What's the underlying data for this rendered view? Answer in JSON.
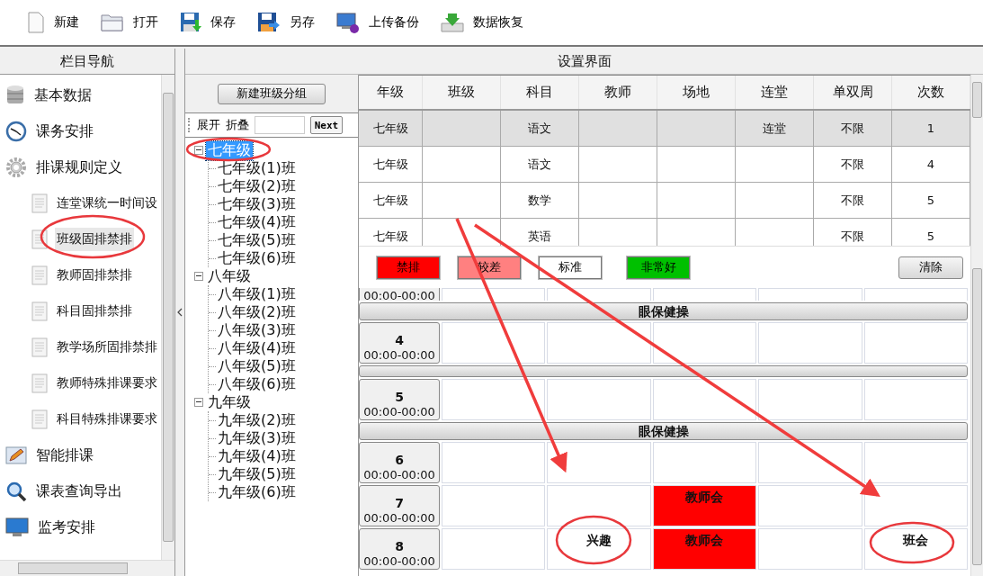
{
  "toolbar": [
    {
      "kind": "new",
      "label": "新建"
    },
    {
      "kind": "open",
      "label": "打开"
    },
    {
      "kind": "save",
      "label": "保存"
    },
    {
      "kind": "saveas",
      "label": "另存"
    },
    {
      "kind": "upload",
      "label": "上传备份"
    },
    {
      "kind": "restore",
      "label": "数据恢复"
    }
  ],
  "nav": {
    "title": "栏目导航",
    "items": [
      {
        "kind": "section",
        "label": "基本数据",
        "selected": false
      },
      {
        "kind": "section",
        "label": "课务安排",
        "selected": false
      },
      {
        "kind": "section",
        "label": "排课规则定义",
        "selected": false
      },
      {
        "kind": "sub",
        "label": "连堂课统一时间设",
        "selected": false
      },
      {
        "kind": "sub",
        "label": "班级固排禁排",
        "selected": true
      },
      {
        "kind": "sub",
        "label": "教师固排禁排",
        "selected": false
      },
      {
        "kind": "sub",
        "label": "科目固排禁排",
        "selected": false
      },
      {
        "kind": "sub",
        "label": "教学场所固排禁排",
        "selected": false
      },
      {
        "kind": "sub",
        "label": "教师特殊排课要求",
        "selected": false
      },
      {
        "kind": "sub",
        "label": "科目特殊排课要求",
        "selected": false
      },
      {
        "kind": "section",
        "label": "智能排课",
        "selected": false
      },
      {
        "kind": "section",
        "label": "课表查询导出",
        "selected": false
      },
      {
        "kind": "section",
        "label": "监考安排",
        "selected": false
      }
    ]
  },
  "panel": {
    "title": "设置界面"
  },
  "class_groups": {
    "new_button": "新建班级分组",
    "expand": "展开",
    "collapse": "折叠",
    "next_button": "Next",
    "tree": [
      {
        "label": "七年级",
        "expanded": true,
        "selected": true,
        "children": [
          {
            "label": "七年级(1)班",
            "selected": false
          },
          {
            "label": "七年级(2)班",
            "selected": false
          },
          {
            "label": "七年级(3)班",
            "selected": false
          },
          {
            "label": "七年级(4)班",
            "selected": false
          },
          {
            "label": "七年级(5)班",
            "selected": false
          },
          {
            "label": "七年级(6)班",
            "selected": false
          }
        ]
      },
      {
        "label": "八年级",
        "expanded": true,
        "selected": false,
        "children": [
          {
            "label": "八年级(1)班",
            "selected": false
          },
          {
            "label": "八年级(2)班",
            "selected": false
          },
          {
            "label": "八年级(3)班",
            "selected": false
          },
          {
            "label": "八年级(4)班",
            "selected": false
          },
          {
            "label": "八年级(5)班",
            "selected": false
          },
          {
            "label": "八年级(6)班",
            "selected": false
          }
        ]
      },
      {
        "label": "九年级",
        "expanded": true,
        "selected": false,
        "children": [
          {
            "label": "九年级(2)班",
            "selected": false
          },
          {
            "label": "九年级(3)班",
            "selected": false
          },
          {
            "label": "九年级(4)班",
            "selected": false
          },
          {
            "label": "九年级(5)班",
            "selected": false
          },
          {
            "label": "九年级(6)班",
            "selected": false
          }
        ]
      }
    ]
  },
  "table": {
    "columns": [
      "年级",
      "班级",
      "科目",
      "教师",
      "场地",
      "连堂",
      "单双周",
      "次数"
    ],
    "rows": [
      {
        "selected": true,
        "cells": [
          "七年级",
          null,
          "语文",
          null,
          null,
          "连堂",
          "不限",
          "1"
        ]
      },
      {
        "selected": false,
        "cells": [
          "七年级",
          null,
          "语文",
          null,
          null,
          null,
          "不限",
          "4"
        ]
      },
      {
        "selected": false,
        "cells": [
          "七年级",
          null,
          "数学",
          null,
          null,
          null,
          "不限",
          "5"
        ]
      },
      {
        "selected": false,
        "cells": [
          "七年级",
          null,
          "英语",
          null,
          null,
          null,
          "不限",
          "5"
        ]
      }
    ]
  },
  "legend": [
    {
      "label": "禁排",
      "color": "#ff0000"
    },
    {
      "label": "较差",
      "color": "#ff8080"
    },
    {
      "label": "标准",
      "color": "#ffffff"
    },
    {
      "label": "非常好",
      "color": "#00c000"
    }
  ],
  "clear_button": "清除",
  "schedule": [
    {
      "kind": "partial",
      "time": "00:00-00:00",
      "cells": [
        {
          "color": "#ffffff"
        },
        {
          "color": "#ffffff"
        },
        {
          "color": "#ffffff"
        },
        {
          "color": "#ffffff"
        },
        {
          "color": "#ffffff"
        }
      ]
    },
    {
      "kind": "break",
      "label": "眼保健操"
    },
    {
      "kind": "period",
      "number": "4",
      "time": "00:00-00:00",
      "cells": [
        {
          "color": "#ffffff"
        },
        {
          "color": "#ffffff"
        },
        {
          "color": "#ffffff"
        },
        {
          "color": "#ffffff"
        },
        {
          "color": "#ffffff"
        }
      ]
    },
    {
      "kind": "break"
    },
    {
      "kind": "period",
      "number": "5",
      "time": "00:00-00:00",
      "cells": [
        {
          "color": "#ffffff"
        },
        {
          "color": "#ffffff"
        },
        {
          "color": "#ffffff"
        },
        {
          "color": "#ffffff"
        },
        {
          "color": "#ffffff"
        }
      ]
    },
    {
      "kind": "break",
      "label": "眼保健操"
    },
    {
      "kind": "period",
      "number": "6",
      "time": "00:00-00:00",
      "cells": [
        {
          "color": "#ffffff"
        },
        {
          "color": "#ffffff"
        },
        {
          "color": "#ffffff"
        },
        {
          "color": "#ffffff"
        },
        {
          "color": "#ffffff"
        }
      ]
    },
    {
      "kind": "period",
      "number": "7",
      "time": "00:00-00:00",
      "cells": [
        {
          "color": "#ffffff"
        },
        {
          "color": "#ffffff"
        },
        {
          "color": "#ff0000",
          "text": "教师会"
        },
        {
          "color": "#ffffff"
        },
        {
          "color": "#ffffff"
        }
      ]
    },
    {
      "kind": "period",
      "number": "8",
      "time": "00:00-00:00",
      "cells": [
        {
          "color": "#ffffff"
        },
        {
          "color": "#ffffff",
          "text": "兴趣"
        },
        {
          "color": "#ff0000",
          "text": "教师会"
        },
        {
          "color": "#ffffff"
        },
        {
          "color": "#ffffff",
          "text": "班会"
        }
      ]
    }
  ]
}
